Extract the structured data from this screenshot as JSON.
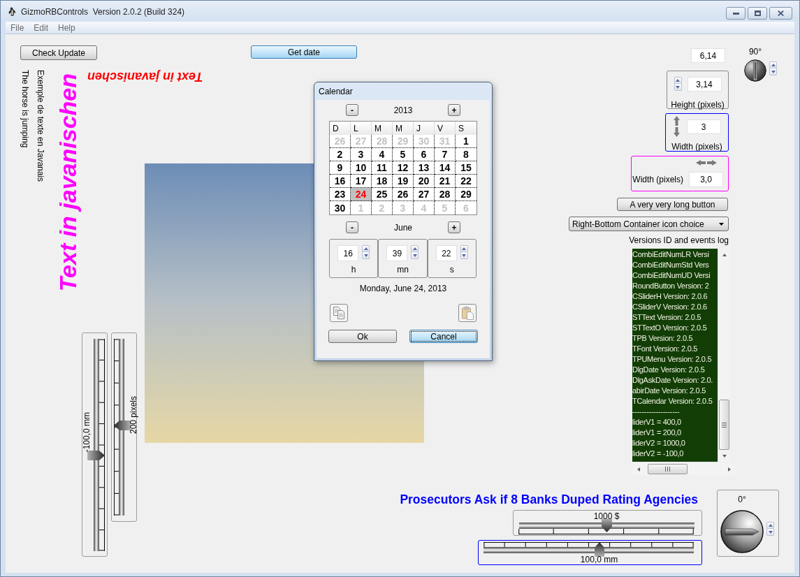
{
  "window": {
    "title": "GizmoRBControls  Version 2.0.2 (Build 324)"
  },
  "menu": [
    "File",
    "Edit",
    "Help"
  ],
  "toolbar_buttons": [
    {
      "label": "Check Update",
      "focused": false
    },
    {
      "label": "Get date",
      "focused": true
    }
  ],
  "rotated_texts": [
    {
      "text": "The horse is jumping",
      "kind": "down",
      "color": "#000000"
    },
    {
      "text": "Exemple de texte en Javanais",
      "kind": "down",
      "color": "#000000"
    },
    {
      "text": "Text in javanischen",
      "kind": "up",
      "color": "#ff00ff"
    },
    {
      "text": "Text in javanischen",
      "kind": "flipped",
      "color": "#ff0000"
    }
  ],
  "left_sliders": [
    {
      "kind": "ticks_right",
      "reading": "-100,0 mm",
      "level": 0.45
    },
    {
      "kind": "ticks_left",
      "reading": "200 pixels",
      "level": 0.51
    }
  ],
  "right_panel": {
    "value_field": "6,14",
    "knob": {
      "reading": "90°"
    },
    "spin_boxes": [
      {
        "kind": "spinner",
        "value": "3,14",
        "label": "Height (pixels)",
        "color": "#8c8c8c"
      },
      {
        "kind": "vertical_arrows",
        "value": "3",
        "label": "Width (pixels)",
        "color": "#0000ff"
      },
      {
        "kind": "horizontal_arrows",
        "value": "3,0",
        "label": "Width (pixels)",
        "color": "#ff00ff"
      }
    ],
    "long_button": "A very very long button",
    "dropdown": {
      "value": "Right-Bottom Container icon choice"
    },
    "log": {
      "label": "Versions ID and events log",
      "lines": [
        "CombiEditNumLR Versi",
        "CombiEditNumStd Vers",
        "CombiEditNumUD Versi",
        "RoundButton Version: 2",
        "CSliderH Version: 2.0.6",
        "CSliderV Version: 2.0.6",
        "STText Version: 2.0.5",
        "STTextO Version: 2.0.5",
        "TPB Version: 2.0.5",
        "TFont Version: 2.0.5",
        "TPUMenu Version: 2.0.5",
        "DlgDate Version: 2.0.5",
        "DlgAskDate Version: 2.0.",
        "abirDate Version: 2.0.5",
        "TCalendar Version: 2.0.5",
        "--------------------",
        "liderV1 = 400,0",
        "liderV1 = 200,0",
        "liderV2 = 1000,0",
        "liderV2 = -100,0"
      ]
    }
  },
  "bottom_panel": {
    "heading": "Prosecutors Ask if 8 Banks Duped Rating Agencies",
    "sliders": [
      {
        "kind": "ticks_below",
        "reading": "1000 $",
        "level": 0.5,
        "focused": false
      },
      {
        "kind": "ticks_above",
        "reading": "100,0 mm",
        "level": 0.55,
        "focused": true
      }
    ],
    "knob": {
      "reading": "0°"
    }
  },
  "calendar_dialog": {
    "title": "Calendar",
    "year": {
      "prev": "-",
      "value": "2013",
      "next": "+"
    },
    "weekdays": [
      "D",
      "L",
      "M",
      "M",
      "J",
      "V",
      "S"
    ],
    "days": [
      {
        "label": "26",
        "outside": true,
        "selected": false
      },
      {
        "label": "27",
        "outside": true,
        "selected": false
      },
      {
        "label": "28",
        "outside": true,
        "selected": false
      },
      {
        "label": "29",
        "outside": true,
        "selected": false
      },
      {
        "label": "30",
        "outside": true,
        "selected": false
      },
      {
        "label": "31",
        "outside": true,
        "selected": false
      },
      {
        "label": "1",
        "outside": false,
        "selected": false
      },
      {
        "label": "2",
        "outside": false,
        "selected": false
      },
      {
        "label": "3",
        "outside": false,
        "selected": false
      },
      {
        "label": "4",
        "outside": false,
        "selected": false
      },
      {
        "label": "5",
        "outside": false,
        "selected": false
      },
      {
        "label": "6",
        "outside": false,
        "selected": false
      },
      {
        "label": "7",
        "outside": false,
        "selected": false
      },
      {
        "label": "8",
        "outside": false,
        "selected": false
      },
      {
        "label": "9",
        "outside": false,
        "selected": false
      },
      {
        "label": "10",
        "outside": false,
        "selected": false
      },
      {
        "label": "11",
        "outside": false,
        "selected": false
      },
      {
        "label": "12",
        "outside": false,
        "selected": false
      },
      {
        "label": "13",
        "outside": false,
        "selected": false
      },
      {
        "label": "14",
        "outside": false,
        "selected": false
      },
      {
        "label": "15",
        "outside": false,
        "selected": false
      },
      {
        "label": "16",
        "outside": false,
        "selected": false
      },
      {
        "label": "17",
        "outside": false,
        "selected": false
      },
      {
        "label": "18",
        "outside": false,
        "selected": false
      },
      {
        "label": "19",
        "outside": false,
        "selected": false
      },
      {
        "label": "20",
        "outside": false,
        "selected": false
      },
      {
        "label": "21",
        "outside": false,
        "selected": false
      },
      {
        "label": "22",
        "outside": false,
        "selected": false
      },
      {
        "label": "23",
        "outside": false,
        "selected": false
      },
      {
        "label": "24",
        "outside": false,
        "selected": true
      },
      {
        "label": "25",
        "outside": false,
        "selected": false
      },
      {
        "label": "26",
        "outside": false,
        "selected": false
      },
      {
        "label": "27",
        "outside": false,
        "selected": false
      },
      {
        "label": "28",
        "outside": false,
        "selected": false
      },
      {
        "label": "29",
        "outside": false,
        "selected": false
      },
      {
        "label": "30",
        "outside": false,
        "selected": false
      },
      {
        "label": "1",
        "outside": true,
        "selected": false
      },
      {
        "label": "2",
        "outside": true,
        "selected": false
      },
      {
        "label": "3",
        "outside": true,
        "selected": false
      },
      {
        "label": "4",
        "outside": true,
        "selected": false
      },
      {
        "label": "5",
        "outside": true,
        "selected": false
      },
      {
        "label": "6",
        "outside": true,
        "selected": false
      }
    ],
    "month": {
      "prev": "-",
      "value": "June",
      "next": "+"
    },
    "time": [
      {
        "value": "16",
        "unit": "h"
      },
      {
        "value": "39",
        "unit": "mn"
      },
      {
        "value": "22",
        "unit": "s"
      }
    ],
    "date_text": "Monday, June 24, 2013",
    "buttons": [
      {
        "label": "Ok",
        "focused": false
      },
      {
        "label": "Cancel",
        "focused": true
      }
    ]
  }
}
